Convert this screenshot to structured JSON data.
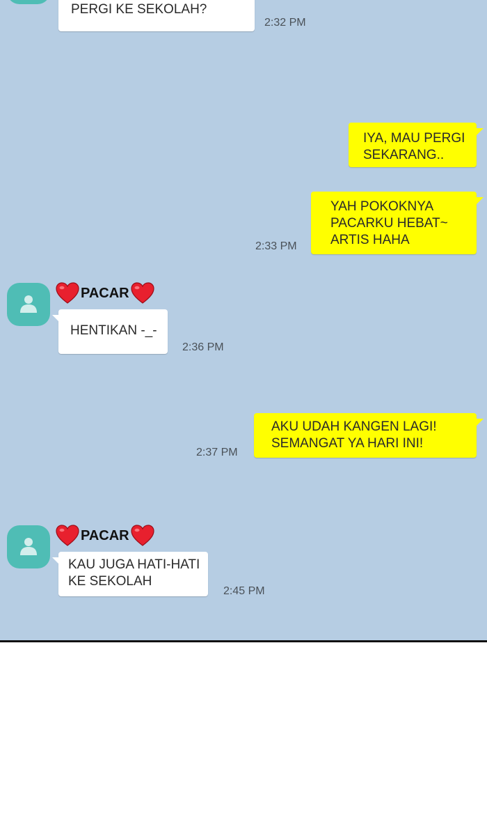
{
  "contact": {
    "name": "PACAR"
  },
  "messages": [
    {
      "side": "in",
      "text": "APA SIH.. UDAHLAH HAHA.\nPERGI KE SEKOLAH?",
      "time": "2:32 PM"
    },
    {
      "side": "out",
      "text": "IYA, MAU PERGI\nSEKARANG..",
      "time": ""
    },
    {
      "side": "out",
      "text": "YAH POKOKNYA\nPACARKU HEBAT~\nARTIS HAHA",
      "time": "2:33 PM"
    },
    {
      "side": "in",
      "text": "HENTIKAN -_-",
      "time": "2:36 PM"
    },
    {
      "side": "out",
      "text": "AKU UDAH KANGEN LAGI!\nSEMANGAT YA HARI INI!",
      "time": "2:37 PM"
    },
    {
      "side": "in",
      "text": "KAU JUGA HATI-HATI\nKE SEKOLAH",
      "time": "2:45 PM"
    }
  ],
  "icons": {
    "avatar": "person-icon",
    "name_decoration": "heart-icon"
  },
  "colors": {
    "chat_background": "#b6cde3",
    "outgoing_bubble": "#ffff00",
    "incoming_bubble": "#ffffff",
    "avatar": "#4fbdb5"
  }
}
